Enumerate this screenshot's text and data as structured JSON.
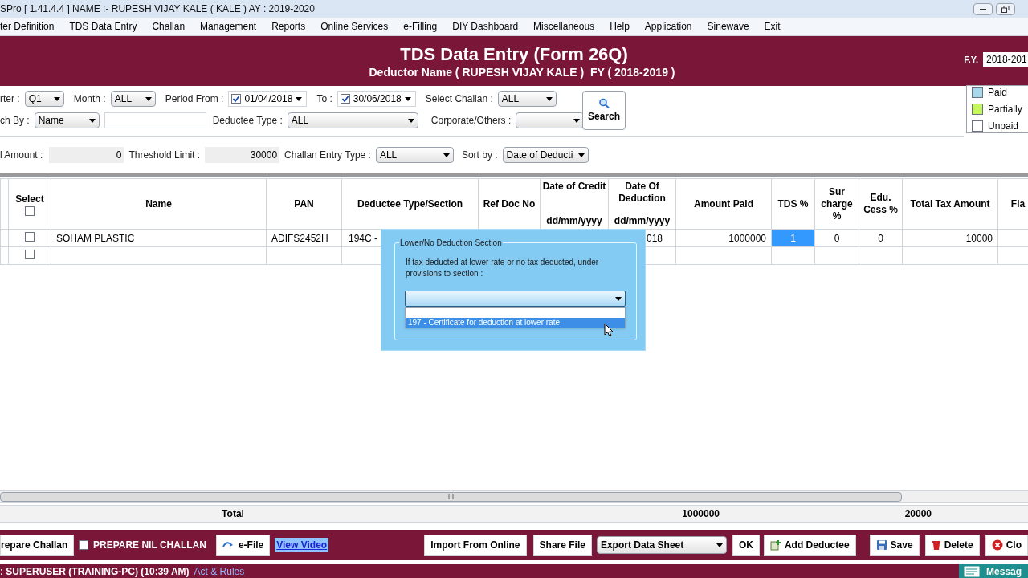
{
  "window": {
    "title": "SPro [ 1.41.4.4 ] NAME :- RUPESH VIJAY KALE ( KALE ) AY : 2019-2020"
  },
  "menu": [
    "ter Definition",
    "TDS Data Entry",
    "Challan",
    "Management",
    "Reports",
    "Online Services",
    "e-Filling",
    "DIY Dashboard",
    "Miscellaneous",
    "Help",
    "Application",
    "Sinewave",
    "Exit"
  ],
  "header": {
    "title": "TDS Data Entry (Form 26Q)",
    "subtitle": "Deductor Name ( RUPESH VIJAY KALE )  FY ( 2018-2019 )",
    "fy_label": "F.Y.",
    "fy_value": "2018-201"
  },
  "filters": {
    "quarter": {
      "label": "rter :",
      "value": "Q1"
    },
    "month": {
      "label": "Month :",
      "value": "ALL"
    },
    "period_from": {
      "label": "Period From :",
      "checked": true,
      "value": "01/04/2018"
    },
    "period_to": {
      "label": "To :",
      "checked": true,
      "value": "30/06/2018"
    },
    "select_challan": {
      "label": "Select Challan :",
      "value": "ALL"
    },
    "search_by": {
      "label": "ch By :",
      "value": "Name"
    },
    "deductee_type": {
      "label": "Deductee Type :",
      "value": "ALL"
    },
    "corporate_others": {
      "label": "Corporate/Others :"
    },
    "amount": {
      "label": "l Amount :",
      "value": "0"
    },
    "threshold_limit": {
      "label": "Threshold Limit :",
      "value": "30000"
    },
    "challan_entry_type": {
      "label": "Challan Entry Type :",
      "value": "ALL"
    },
    "sort_by": {
      "label": "Sort by :",
      "value": "Date of Deducti"
    },
    "search_button": "Search"
  },
  "legend": [
    {
      "label": "Paid",
      "color": "#a8d8ea"
    },
    {
      "label": "Partially",
      "color": "#c6f562"
    },
    {
      "label": "Unpaid",
      "color": "#ffffff"
    }
  ],
  "table": {
    "select_all": {
      "label": "Select",
      "checked": false
    },
    "columns": [
      {
        "label": "Name"
      },
      {
        "label": "PAN"
      },
      {
        "label": "Deductee Type/Section"
      },
      {
        "label": "Ref Doc No"
      },
      {
        "label": "Date of Credit",
        "sublabel": "dd/mm/yyyy"
      },
      {
        "label": "Date Of Deduction",
        "sublabel": "dd/mm/yyyy"
      },
      {
        "label": "Amount Paid"
      },
      {
        "label": "TDS %"
      },
      {
        "label": "Sur charge %"
      },
      {
        "label": "Edu. Cess %"
      },
      {
        "label": "Total Tax Amount"
      },
      {
        "label": "Fla"
      }
    ],
    "rows": [
      {
        "checked": false,
        "cells": [
          {
            "text": "SOHAM PLASTIC",
            "selected": false
          },
          {
            "text": "ADIFS2452H",
            "selected": false
          },
          {
            "text": "194C -",
            "selected": false
          },
          {},
          {},
          {
            "text": "018",
            "selected": false
          },
          {
            "text": "1000000",
            "selected": false
          },
          {
            "text": "1",
            "selected": true
          },
          {
            "text": "0",
            "selected": false
          },
          {
            "text": "0",
            "selected": false
          },
          {
            "text": "10000",
            "selected": false
          },
          {
            "selected": false
          }
        ]
      },
      {
        "checked": false,
        "cells": [
          {
            "selected": false
          },
          {
            "selected": false
          },
          {
            "selected": false
          },
          {},
          {},
          {
            "selected": false
          },
          {
            "selected": false
          },
          {
            "selected": false
          },
          {
            "selected": false
          },
          {
            "selected": false
          },
          {
            "selected": false
          },
          {
            "selected": false
          }
        ]
      }
    ],
    "total": {
      "label": "Total",
      "amount_paid": "1000000",
      "total_tax": "20000"
    }
  },
  "dialog": {
    "legend": "Lower/No Deduction Section",
    "text": "If tax deducted at lower rate or no tax deducted, under provisions to section :",
    "options": [
      {
        "selected": false
      },
      {
        "text": "197 - Certificate for deduction at lower rate",
        "selected": true
      }
    ]
  },
  "toolbar": {
    "prepare_challan": "repare Challan",
    "nil_challan": {
      "label": "PREPARE NIL CHALLAN",
      "checked": false
    },
    "efile": "e-File",
    "view_video": "View Video",
    "import": "Import From Online",
    "share": "Share File",
    "export": "Export Data Sheet",
    "ok": "OK",
    "add": "Add Deductee",
    "save": "Save",
    "delete": "Delete",
    "close": "Clo"
  },
  "status_bar": {
    "user": ": SUPERUSER (TRAINING-PC) (10:39 AM)",
    "link": "Act & Rules",
    "messages": "Messag"
  }
}
